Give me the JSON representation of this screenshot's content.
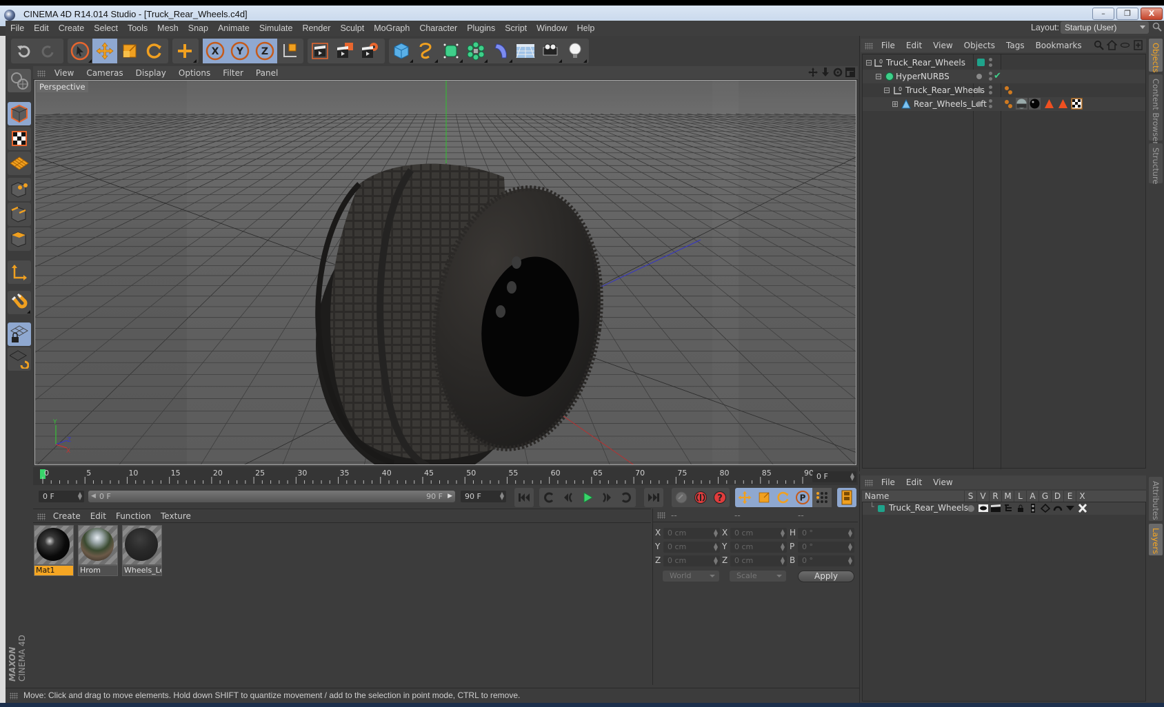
{
  "window": {
    "title": "CINEMA 4D R14.014 Studio - [Truck_Rear_Wheels.c4d]",
    "buttons": {
      "minimize": "–",
      "restore": "❐",
      "close": "X"
    }
  },
  "menubar": {
    "items": [
      "File",
      "Edit",
      "Create",
      "Select",
      "Tools",
      "Mesh",
      "Snap",
      "Animate",
      "Simulate",
      "Render",
      "Sculpt",
      "MoGraph",
      "Character",
      "Plugins",
      "Script",
      "Window",
      "Help"
    ],
    "layout_label": "Layout:",
    "layout_value": "Startup (User)"
  },
  "toolbar": {
    "groups": [
      {
        "name": "history",
        "items": [
          "undo-icon",
          "redo-icon"
        ]
      },
      {
        "name": "tools",
        "items": [
          "live-selection-icon",
          "move-icon",
          "scale-icon",
          "rotate-icon"
        ]
      },
      {
        "name": "last-tool",
        "items": [
          "add-tool-icon"
        ]
      },
      {
        "name": "axes",
        "items": [
          "x-axis-lock-icon",
          "y-axis-lock-icon",
          "z-axis-lock-icon",
          "coordinate-system-icon"
        ]
      },
      {
        "name": "render",
        "items": [
          "render-view-icon",
          "render-picture-viewer-icon",
          "render-settings-icon"
        ]
      },
      {
        "name": "objects",
        "items": [
          "cube-primitive-icon",
          "spline-icon",
          "nurbs-icon",
          "array-icon",
          "deformer-icon",
          "floor-icon",
          "camera-icon",
          "light-icon"
        ]
      }
    ]
  },
  "left_tools": [
    "workplane-icon",
    "model-mode-icon",
    "texture-mode-icon",
    "workplane-mode-icon",
    "points-mode-icon",
    "edges-mode-icon",
    "polygons-mode-icon",
    "axis-mode-icon",
    "snap-magnet-icon",
    "locked-workplane-icon",
    "planar-workplane-icon"
  ],
  "viewport": {
    "menu": [
      "View",
      "Cameras",
      "Display",
      "Options",
      "Filter",
      "Panel"
    ],
    "camera_label": "Perspective",
    "axis_labels": {
      "x": "X",
      "y": "Y",
      "z": "Z"
    }
  },
  "timeline": {
    "ticks": [
      "0",
      "5",
      "10",
      "15",
      "20",
      "25",
      "30",
      "35",
      "40",
      "45",
      "50",
      "55",
      "60",
      "65",
      "70",
      "75",
      "80",
      "85",
      "90"
    ],
    "current_frame": "0 F",
    "start_frame": "0 F",
    "slider_start": "0 F",
    "slider_end": "90 F",
    "end_frame": "90 F"
  },
  "materials": {
    "menu": [
      "Create",
      "Edit",
      "Function",
      "Texture"
    ],
    "items": [
      {
        "name": "Mat1",
        "selected": true,
        "style": "black-glossy"
      },
      {
        "name": "Hrom",
        "selected": false,
        "style": "chrome"
      },
      {
        "name": "Wheels_Lef",
        "selected": false,
        "style": "dark-matte"
      }
    ]
  },
  "coordinates": {
    "headers": [
      "--",
      "--",
      "--"
    ],
    "rows": [
      {
        "a": "X",
        "av": "0 cm",
        "b": "X",
        "bv": "0 cm",
        "c": "H",
        "cv": "0 °"
      },
      {
        "a": "Y",
        "av": "0 cm",
        "b": "Y",
        "bv": "0 cm",
        "c": "P",
        "cv": "0 °"
      },
      {
        "a": "Z",
        "av": "0 cm",
        "b": "Z",
        "bv": "0 cm",
        "c": "B",
        "cv": "0 °"
      }
    ],
    "mode_select": "World",
    "scale_select": "Scale",
    "apply_label": "Apply"
  },
  "object_manager": {
    "menu": [
      "File",
      "Edit",
      "View",
      "Objects",
      "Tags",
      "Bookmarks"
    ],
    "objects": [
      {
        "name": "Truck_Rear_Wheels",
        "type": "null",
        "indent": 0,
        "expanded": true
      },
      {
        "name": "HyperNURBS",
        "type": "hypernurbs",
        "indent": 1,
        "expanded": true
      },
      {
        "name": "Truck_Rear_Wheels",
        "type": "null",
        "indent": 2,
        "expanded": true
      },
      {
        "name": "Rear_Wheels_Left",
        "type": "polygon",
        "indent": 3,
        "expanded": false
      }
    ]
  },
  "side_tabs_top": [
    {
      "label": "Objects",
      "active": true
    },
    {
      "label": "Content Browser",
      "active": false
    },
    {
      "label": "Structure",
      "active": false
    }
  ],
  "layer_manager": {
    "menu": [
      "File",
      "Edit",
      "View"
    ],
    "columns": [
      "Name",
      "S",
      "V",
      "R",
      "M",
      "L",
      "A",
      "G",
      "D",
      "E",
      "X"
    ],
    "rows": [
      {
        "name": "Truck_Rear_Wheels",
        "color": "#1fa38b"
      }
    ]
  },
  "side_tabs_bottom": [
    {
      "label": "Attributes",
      "active": false
    },
    {
      "label": "Layers",
      "active": true
    }
  ],
  "status": {
    "text": "Move: Click and drag to move elements. Hold down SHIFT to quantize movement / add to the selection in point mode, CTRL to remove."
  },
  "branding": {
    "maker": "MAXON",
    "product": "CINEMA 4D"
  },
  "colors": {
    "accent_orange": "#f5a623",
    "selected_blue": "#8fa8d0",
    "layer_teal": "#1fa38b",
    "play_green": "#38d46a"
  }
}
